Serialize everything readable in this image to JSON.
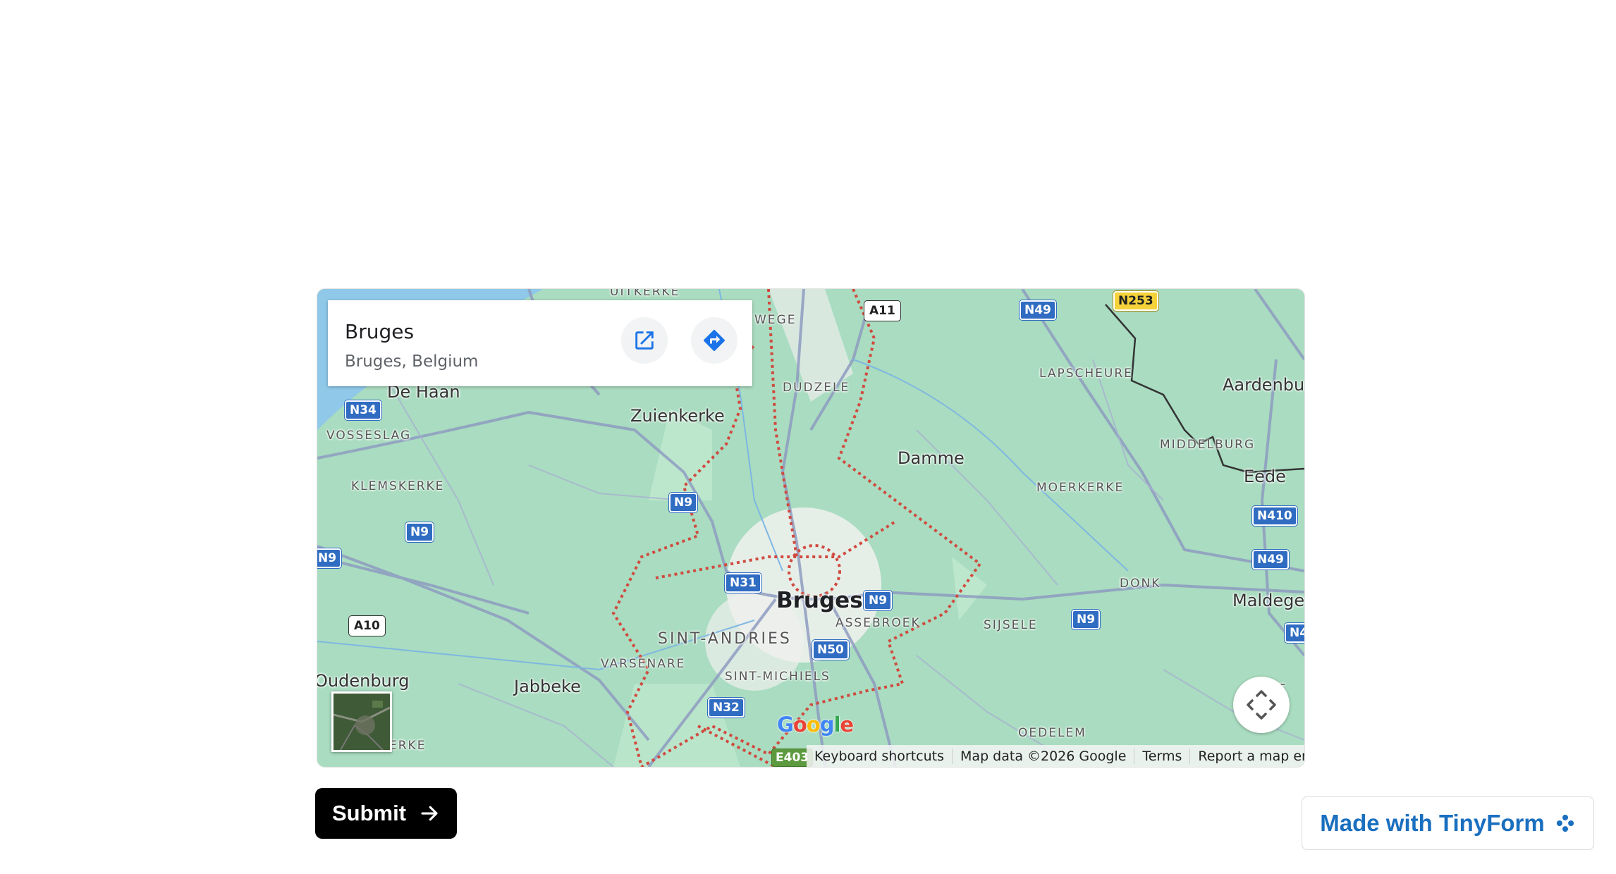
{
  "map": {
    "place_title": "Bruges",
    "place_subtitle": "Bruges, Belgium",
    "icons": {
      "open_external": "open-in-new-icon",
      "directions": "directions-icon",
      "fullscreen": "fullscreen-icon"
    },
    "labels": {
      "uitkerke": "UITKERKE",
      "wege": "WEGE",
      "de_haan": "De Haan",
      "dudzele": "DUDZELE",
      "lapscheure": "LAPSCHEURE",
      "aardenburg": "Aardenburg",
      "zuienkerke": "Zuienkerke",
      "vosseslag": "VOSSESLAG",
      "middelburg": "MIDDELBURG",
      "damme": "Damme",
      "eede": "Eede",
      "klemskerke": "KLEMSKERKE",
      "moerkerke": "MOERKERKE",
      "donk": "DONK",
      "bruges": "Bruges",
      "maldegem": "Maldegen",
      "assebroek": "ASSEBROEK",
      "sijsele": "SIJSELE",
      "sint_andries": "SINT-ANDRIES",
      "varsenare": "VARSENARE",
      "sint_michiels": "SINT-MICHIELS",
      "oudenburg": "Oudenburg",
      "jabbeke": "Jabbeke",
      "oedelem": "OEDELEM",
      "erke": "ERKE",
      "t_frag": "T"
    },
    "roads": {
      "a11": "A11",
      "n49_top": "N49",
      "n253": "N253",
      "n34": "N34",
      "n9_center": "N9",
      "n9_left": "N9",
      "n9_edge": "N9",
      "n410": "N410",
      "n49_right": "N49",
      "n31": "N31",
      "n9_bruges": "N9",
      "a10": "A10",
      "n9_right": "N9",
      "n4_edge": "N4",
      "n50": "N50",
      "n32": "N32",
      "e403": "E403"
    },
    "google_logo": "Google",
    "attribution": {
      "shortcuts": "Keyboard shortcuts",
      "map_data": "Map data ©2026 Google",
      "terms": "Terms",
      "report": "Report a map error"
    }
  },
  "form": {
    "submit_label": "Submit",
    "submit_icon": "arrow-right-icon"
  },
  "branding": {
    "made_with": "Made with TinyForm",
    "icon": "tinyform-flower-icon",
    "color": "#1a6fbf"
  }
}
